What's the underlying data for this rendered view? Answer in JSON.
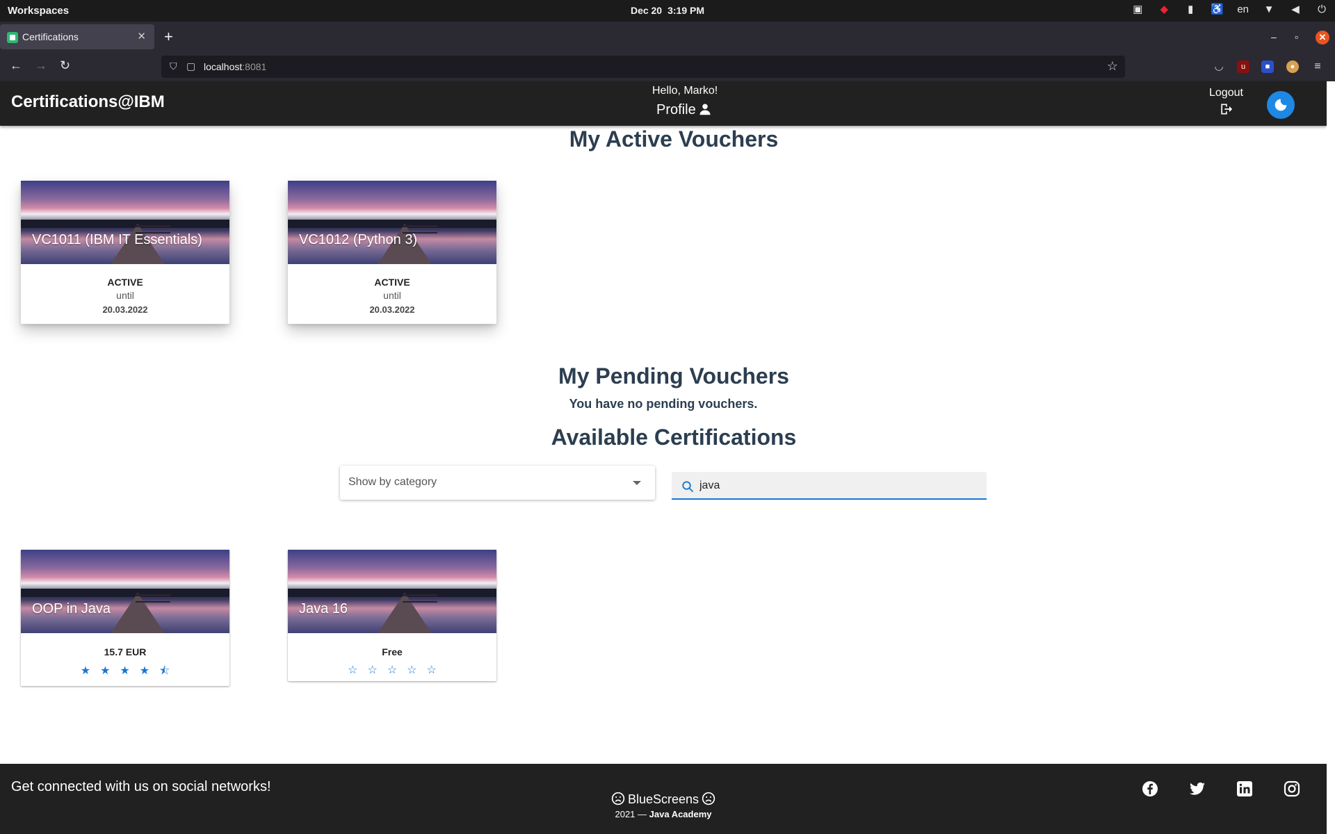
{
  "os": {
    "workspaces": "Workspaces",
    "date": "Dec 20",
    "time": "3:19 PM",
    "lang": "en"
  },
  "browser": {
    "tab_title": "Certifications",
    "url_host": "localhost",
    "url_port": ":8081"
  },
  "header": {
    "brand": "Certifications@IBM",
    "greeting": "Hello, Marko!",
    "profile": "Profile",
    "logout": "Logout"
  },
  "active": {
    "title": "My Active Vouchers",
    "cards": [
      {
        "title": "VC1011 (IBM IT Essentials)",
        "status": "ACTIVE",
        "until": "until",
        "date": "20.03.2022"
      },
      {
        "title": "VC1012 (Python 3)",
        "status": "ACTIVE",
        "until": "until",
        "date": "20.03.2022"
      }
    ]
  },
  "pending": {
    "title": "My Pending Vouchers",
    "empty_message": "You have no pending vouchers."
  },
  "available": {
    "title": "Available Certifications",
    "category_placeholder": "Show by category",
    "search_value": "java",
    "cards": [
      {
        "title": "OOP in Java",
        "price": "15.7 EUR",
        "rating": 4.5,
        "stars": "★★★★⯪"
      },
      {
        "title": "Java 16",
        "price": "Free",
        "rating": 0,
        "stars": "☆☆☆☆☆"
      }
    ]
  },
  "footer": {
    "connect": "Get connected with us on social networks!",
    "team": "BlueScreens",
    "copyright_prefix": "2021 — ",
    "academy": "Java Academy"
  },
  "colors": {
    "accent": "#1976d2",
    "header_bg": "#212121",
    "heading": "#2c3e50"
  }
}
